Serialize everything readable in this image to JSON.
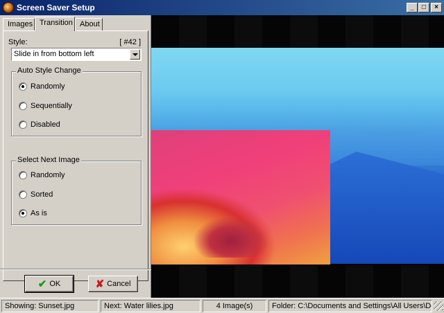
{
  "window": {
    "title": "Screen Saver Setup",
    "controls": {
      "minimize": "_",
      "maximize": "□",
      "close": "×"
    }
  },
  "tabs": [
    {
      "label": "Images",
      "active": false
    },
    {
      "label": "Transition",
      "active": true
    },
    {
      "label": "About",
      "active": false
    }
  ],
  "style": {
    "label": "Style:",
    "number": "[ #42 ]",
    "selected": "Slide in from bottom left"
  },
  "auto_style_change": {
    "legend": "Auto Style Change",
    "options": [
      {
        "label": "Randomly",
        "checked": true
      },
      {
        "label": "Sequentially",
        "checked": false
      },
      {
        "label": "Disabled",
        "checked": false
      }
    ]
  },
  "select_next_image": {
    "legend": "Select Next Image",
    "options": [
      {
        "label": "Randomly",
        "checked": false
      },
      {
        "label": "Sorted",
        "checked": false
      },
      {
        "label": "As is",
        "checked": true
      }
    ]
  },
  "buttons": {
    "ok": "OK",
    "cancel": "Cancel"
  },
  "icons": {
    "ok": "check-icon",
    "cancel": "x-icon",
    "app": "screensaver-app-icon"
  },
  "status": {
    "showing": "Showing: Sunset.jpg",
    "next": "Next: Water lilies.jpg",
    "count": "4 Image(s)",
    "folder": "Folder: C:\\Documents and Settings\\All Users\\Docum"
  }
}
